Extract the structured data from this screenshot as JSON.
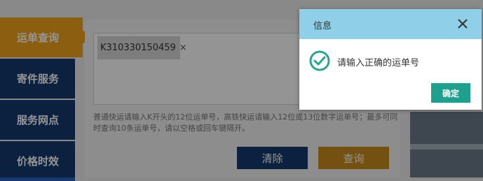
{
  "nav": {
    "items": [
      {
        "label": "运单查询",
        "active": true
      },
      {
        "label": "寄件服务",
        "active": false
      },
      {
        "label": "服务网点",
        "active": false
      },
      {
        "label": "价格时效",
        "active": false
      }
    ]
  },
  "query": {
    "tag_value": "K310330150459",
    "tag_remove": "×",
    "hint": "普通快运请输入K开头的12位运单号，高铁快运请输入12位或13位数字运单号；最多可同时查询10条运单号，请以空格或回车键隔开。",
    "clear_label": "清除",
    "query_label": "查询"
  },
  "dialog": {
    "title": "信息",
    "message": "请输入正确的运单号",
    "ok_label": "确定"
  },
  "colors": {
    "nav_bg": "#163a6f",
    "nav_active": "#f0a31c",
    "query_button": "#c98a1e",
    "dialog_header": "#8fcfe8",
    "dialog_ok": "#1f9f8e",
    "success_icon": "#2aa58f"
  },
  "icons": {
    "close": "close-icon",
    "success": "check-circle-icon"
  }
}
